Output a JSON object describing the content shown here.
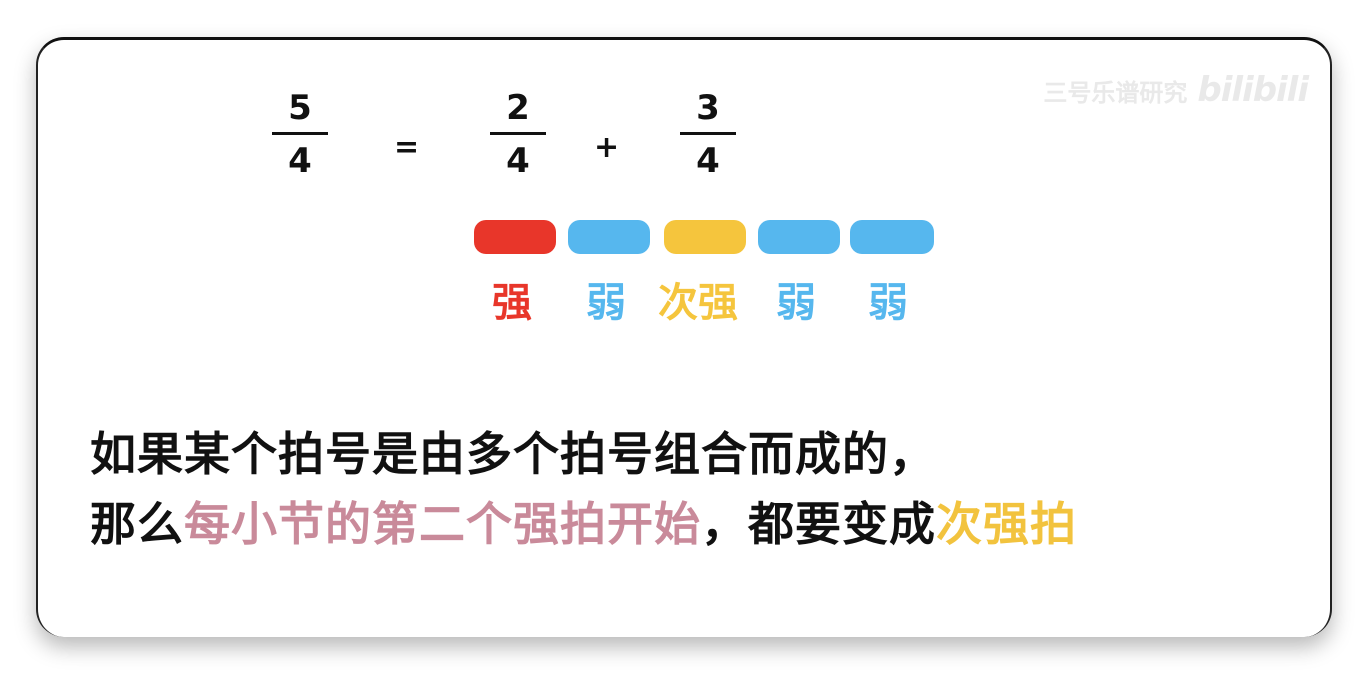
{
  "equation": {
    "left": {
      "numerator": "5",
      "denominator": "4"
    },
    "equals": "=",
    "part1": {
      "numerator": "2",
      "denominator": "4"
    },
    "plus": "+",
    "part2": {
      "numerator": "3",
      "denominator": "4"
    }
  },
  "pills": [
    {
      "color": "#e8362a"
    },
    {
      "color": "#56b7ee"
    },
    {
      "color": "#f5c53d"
    },
    {
      "color": "#56b7ee"
    },
    {
      "color": "#56b7ee"
    }
  ],
  "beats": [
    {
      "label": "强",
      "color": "#e8362a"
    },
    {
      "label": "弱",
      "color": "#56b7ee"
    },
    {
      "label": "次强",
      "color": "#f5c53d"
    },
    {
      "label": "弱",
      "color": "#56b7ee"
    },
    {
      "label": "弱",
      "color": "#56b7ee"
    }
  ],
  "text": {
    "line1": "如果某个拍号是由多个拍号组合而成的，",
    "line2_a": "那么",
    "line2_b": "每小节的第二个强拍开始",
    "line2_c": "，都要变成",
    "line2_d": "次强拍"
  },
  "watermark": {
    "channel": "三号乐谱研究",
    "brand": "bilibili"
  }
}
